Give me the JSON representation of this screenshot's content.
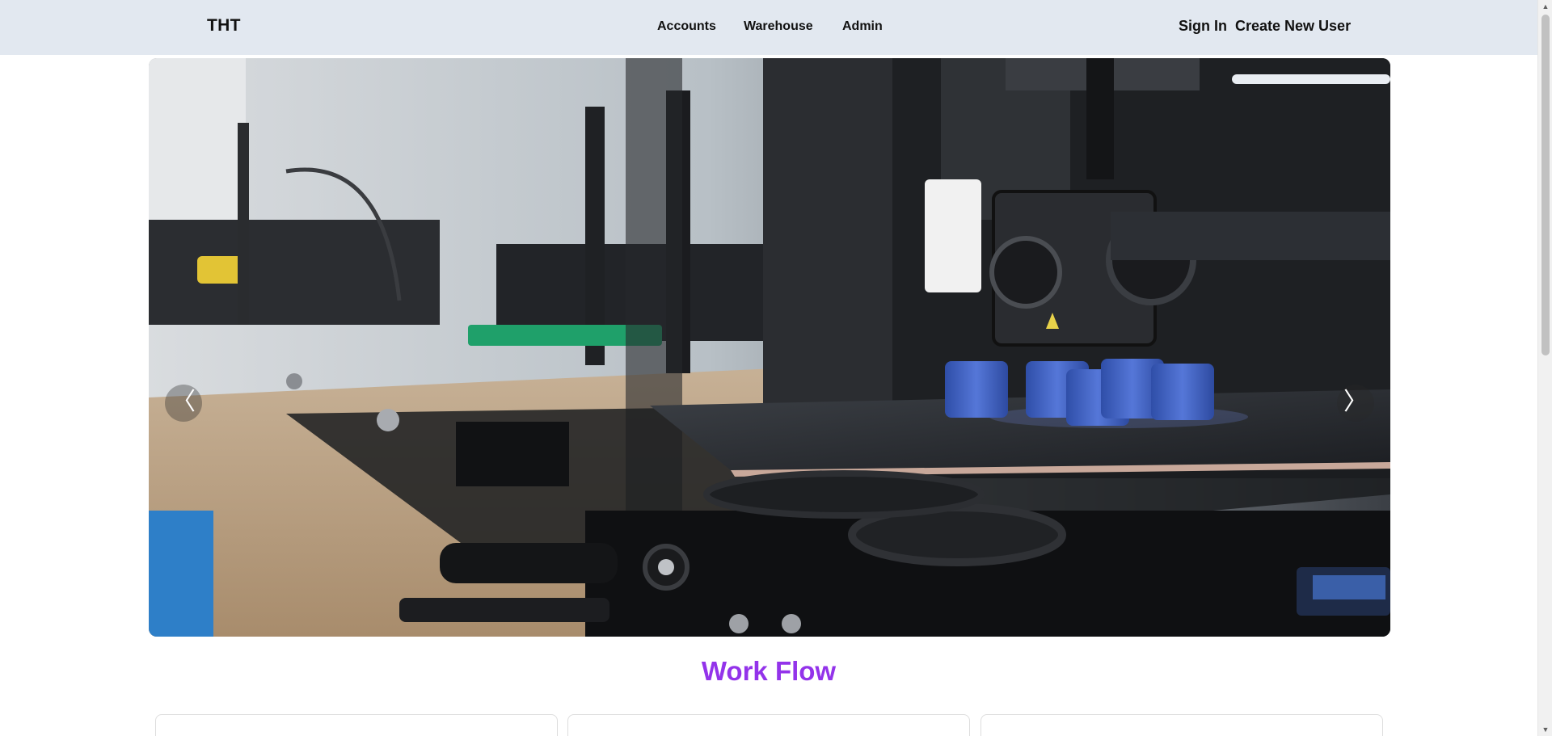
{
  "header": {
    "brand": "THT",
    "nav": {
      "accounts": "Accounts",
      "warehouse": "Warehouse",
      "admin": "Admin"
    },
    "auth": {
      "sign_in": "Sign In",
      "create_user": "Create New User"
    }
  },
  "carousel": {
    "image_subject": "3D printers on a workbench",
    "prev_icon": "chevron-left-icon",
    "next_icon": "chevron-right-icon",
    "prev_glyph": "〈",
    "next_glyph": "〉"
  },
  "main": {
    "section_title": "Work Flow"
  },
  "colors": {
    "navbar_bg": "#e2e8f0",
    "accent": "#9333ea",
    "print_blue": "#3f5fc4"
  }
}
